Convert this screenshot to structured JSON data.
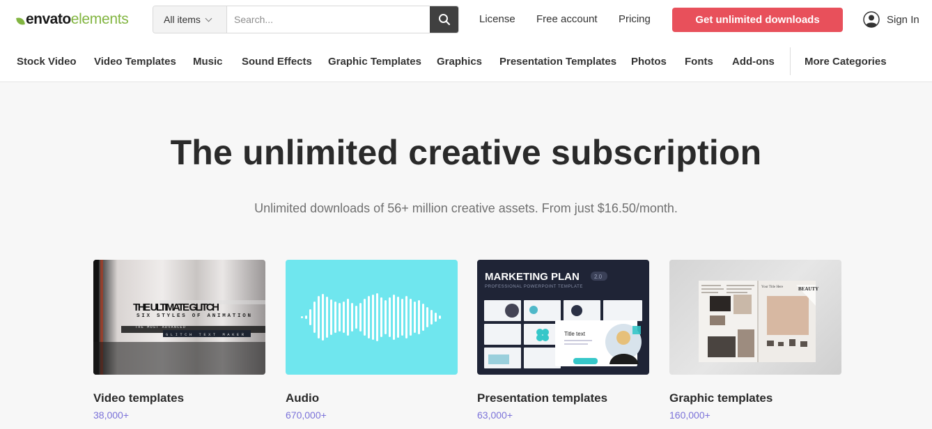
{
  "logo": {
    "word1": "envato",
    "word2": "elements"
  },
  "search": {
    "scope": "All items",
    "placeholder": "Search..."
  },
  "toplinks": {
    "license": "License",
    "free_account": "Free account",
    "pricing": "Pricing"
  },
  "cta": "Get unlimited downloads",
  "signin": "Sign In",
  "categories": [
    "Stock Video",
    "Video Templates",
    "Music",
    "Sound Effects",
    "Graphic Templates",
    "Graphics",
    "Presentation Templates",
    "Photos",
    "Fonts",
    "Add-ons",
    "More Categories"
  ],
  "hero": {
    "title": "The unlimited creative subscription",
    "subtitle": "Unlimited downloads of 56+ million creative assets. From just $16.50/month."
  },
  "cards": [
    {
      "title": "Video templates",
      "count": "38,000+"
    },
    {
      "title": "Audio",
      "count": "670,000+"
    },
    {
      "title": "Presentation templates",
      "count": "63,000+"
    },
    {
      "title": "Graphic templates",
      "count": "160,000+"
    }
  ],
  "thumb_text": {
    "video_line1": "THE ULTIMATE GLITCH",
    "video_line2": "SIX STYLES OF ANIMATION",
    "video_line3": "THE MOST ADVANCED",
    "video_line4": "GLITCH TEXT MAKER",
    "pres_title": "MARKETING PLAN",
    "pres_badge": "2.0",
    "pres_subtitle": "PROFESSIONAL POWERPOINT TEMPLATE",
    "pres_slide_title": "Title text",
    "graphic_heading": "BEAUTY",
    "graphic_page_title": "Your Title Here"
  },
  "colors": {
    "accent": "#e8505b",
    "brand_green": "#82b541",
    "count_purple": "#7b72d9",
    "audio_bg": "#6fe6ee",
    "search_button": "#404040"
  }
}
